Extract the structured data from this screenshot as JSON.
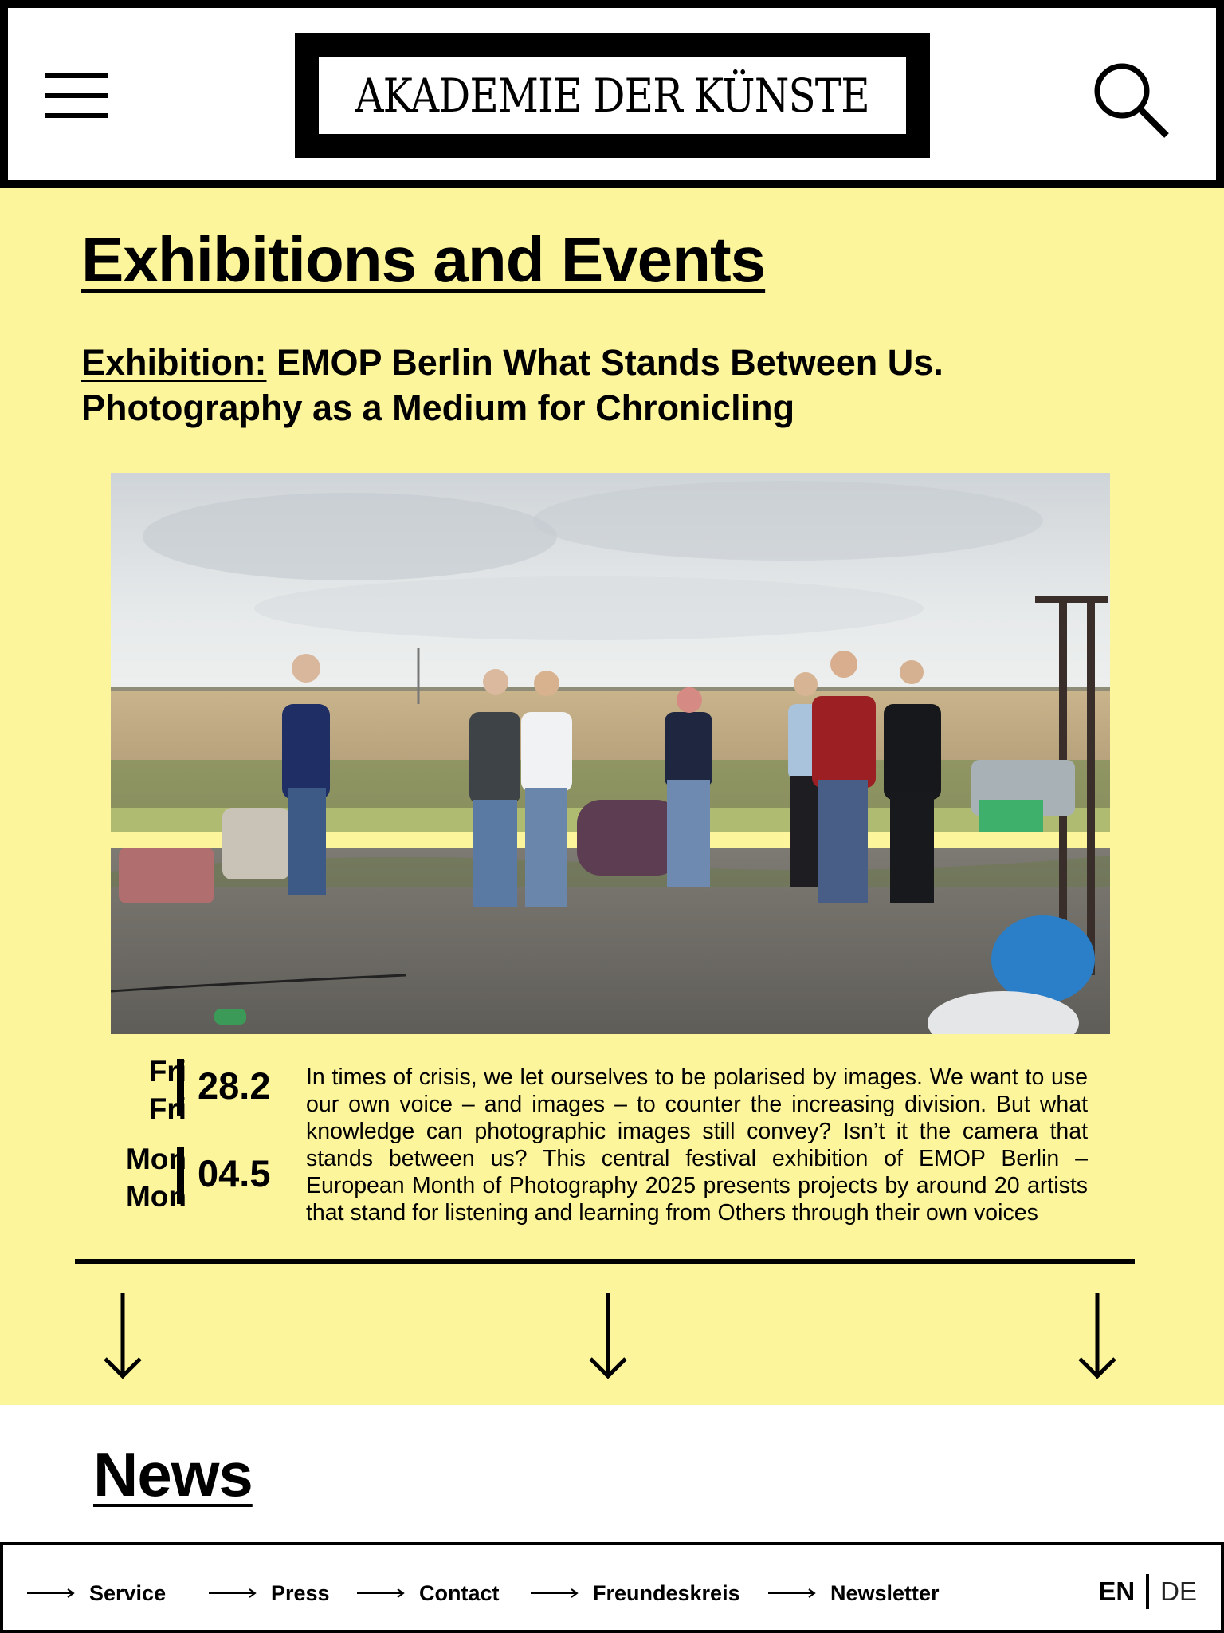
{
  "header": {
    "menu_icon": "hamburger-menu-icon",
    "logo_text": "AKADEMIE DER KÜNSTE",
    "search_icon": "search-icon"
  },
  "events": {
    "background_color": "#fdf59c",
    "section_title": "Exhibitions and Events",
    "event": {
      "category": "Exhibition:",
      "title": "EMOP Berlin What Stands Between Us. Photography as a Medium for Chronicling",
      "start": {
        "day_1": "Fri",
        "day_2": "Fri",
        "date": "28.2"
      },
      "end": {
        "day_1": "Mon",
        "day_2": "Mon",
        "date": "04.5"
      },
      "description": "In times of crisis, we let ourselves to be polarised by images. We want to use our own voice – and images – to counter the increasing division. But what knowledge can photographic images still convey? Isn’t it the camera that stands between us? This central festival exhibition of EMOP Berlin – European Month of Photography 2025 presents projects by around 20 artists that stand for listening and learning from Others through their own voices"
    },
    "arrow_icon": "arrow-down-icon"
  },
  "news": {
    "title": "News"
  },
  "footer": {
    "links": [
      {
        "label": "Service"
      },
      {
        "label": "Press"
      },
      {
        "label": "Contact"
      },
      {
        "label": "Freundeskreis"
      },
      {
        "label": "Newsletter"
      }
    ],
    "link_icon": "arrow-right-icon",
    "lang_active": "EN",
    "lang_other": "DE"
  }
}
